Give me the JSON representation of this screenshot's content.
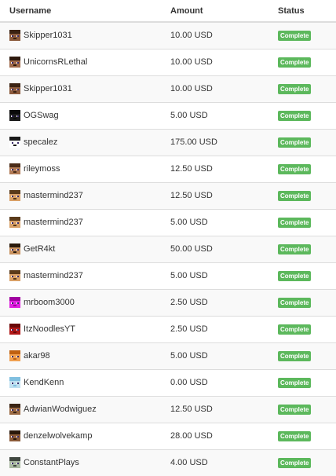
{
  "headers": {
    "username": "Username",
    "amount": "Amount",
    "status": "Status"
  },
  "colors": {
    "complete_badge": "#5cb85c",
    "row_stripe": "#f9f9f9",
    "border": "#dddddd"
  },
  "rows": [
    {
      "username": "Skipper1031",
      "amount": "10.00 USD",
      "status": "Complete",
      "avatar": {
        "icon": "player-skin-icon",
        "skin": "#8b5a3c",
        "hair": "#3b2213"
      }
    },
    {
      "username": "UnicornsRLethal",
      "amount": "10.00 USD",
      "status": "Complete",
      "avatar": {
        "icon": "player-skin-icon",
        "skin": "#a06a4a",
        "hair": "#2e1a0e"
      }
    },
    {
      "username": "Skipper1031",
      "amount": "10.00 USD",
      "status": "Complete",
      "avatar": {
        "icon": "player-skin-icon",
        "skin": "#8b5a3c",
        "hair": "#3b2213"
      }
    },
    {
      "username": "OGSwag",
      "amount": "5.00 USD",
      "status": "Complete",
      "avatar": {
        "icon": "player-skin-icon",
        "skin": "#1a1a1a",
        "hair": "#0a0a0a"
      }
    },
    {
      "username": "specalez",
      "amount": "175.00 USD",
      "status": "Complete",
      "avatar": {
        "icon": "panda-skin-icon",
        "skin": "#ffffff",
        "hair": "#1a1a1a"
      }
    },
    {
      "username": "rileymoss",
      "amount": "12.50 USD",
      "status": "Complete",
      "avatar": {
        "icon": "player-skin-icon",
        "skin": "#b07a55",
        "hair": "#4a2c18"
      }
    },
    {
      "username": "mastermind237",
      "amount": "12.50 USD",
      "status": "Complete",
      "avatar": {
        "icon": "player-skin-icon",
        "skin": "#d9a066",
        "hair": "#5a3a1a"
      }
    },
    {
      "username": "mastermind237",
      "amount": "5.00 USD",
      "status": "Complete",
      "avatar": {
        "icon": "player-skin-icon",
        "skin": "#d9a066",
        "hair": "#5a3a1a"
      }
    },
    {
      "username": "GetR4kt",
      "amount": "50.00 USD",
      "status": "Complete",
      "avatar": {
        "icon": "player-skin-icon",
        "skin": "#c8925f",
        "hair": "#2a1a0c"
      }
    },
    {
      "username": "mastermind237",
      "amount": "5.00 USD",
      "status": "Complete",
      "avatar": {
        "icon": "player-skin-icon",
        "skin": "#d9a066",
        "hair": "#5a3a1a"
      }
    },
    {
      "username": "mrboom3000",
      "amount": "2.50 USD",
      "status": "Complete",
      "avatar": {
        "icon": "player-skin-icon",
        "skin": "#e020e0",
        "hair": "#a000a0"
      }
    },
    {
      "username": "ItzNoodlesYT",
      "amount": "2.50 USD",
      "status": "Complete",
      "avatar": {
        "icon": "player-skin-icon",
        "skin": "#b01818",
        "hair": "#6a0808"
      }
    },
    {
      "username": "akar98",
      "amount": "5.00 USD",
      "status": "Complete",
      "avatar": {
        "icon": "player-skin-icon",
        "skin": "#f0a050",
        "hair": "#c06010"
      }
    },
    {
      "username": "KendKenn",
      "amount": "0.00 USD",
      "status": "Complete",
      "avatar": {
        "icon": "player-skin-icon",
        "skin": "#bfe0f0",
        "hair": "#80c0e0"
      }
    },
    {
      "username": "AdwianWodwiguez",
      "amount": "12.50 USD",
      "status": "Complete",
      "avatar": {
        "icon": "player-skin-icon",
        "skin": "#9a6a44",
        "hair": "#3a2414"
      }
    },
    {
      "username": "denzelwolvekamp",
      "amount": "28.00 USD",
      "status": "Complete",
      "avatar": {
        "icon": "player-skin-icon",
        "skin": "#8a5a38",
        "hair": "#2a180a"
      }
    },
    {
      "username": "ConstantPlays",
      "amount": "4.00 USD",
      "status": "Complete",
      "avatar": {
        "icon": "player-skin-icon",
        "skin": "#a8b8a0",
        "hair": "#404840"
      }
    }
  ]
}
